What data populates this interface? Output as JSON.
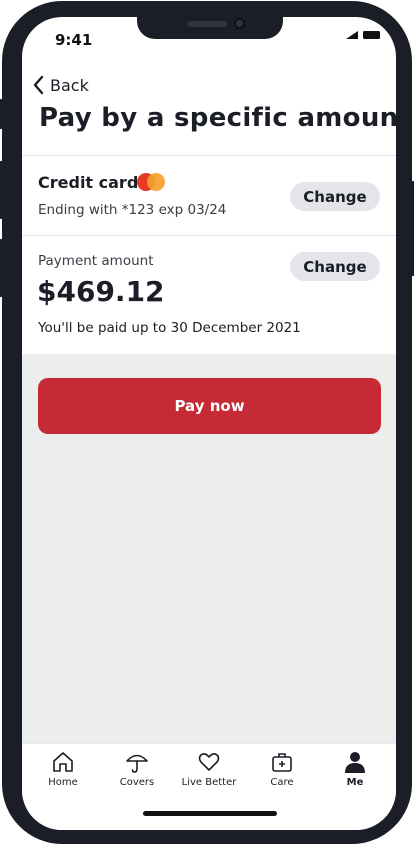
{
  "status_bar": {
    "time": "9:41"
  },
  "nav": {
    "back_label": "Back"
  },
  "page": {
    "title": "Pay by a specific amount"
  },
  "payment_method": {
    "title": "Credit card",
    "card_brand_icon": "mastercard-logo",
    "detail": "Ending with *123  exp 03/24",
    "change_label": "Change"
  },
  "payment_amount": {
    "label": "Payment amount",
    "value": "$469.12",
    "paid_up_text": "You'll be paid up to 30 December 2021",
    "change_label": "Change"
  },
  "actions": {
    "pay_now_label": "Pay now"
  },
  "tabbar": {
    "items": [
      {
        "label": "Home",
        "icon": "home-icon",
        "active": false
      },
      {
        "label": "Covers",
        "icon": "umbrella-icon",
        "active": false
      },
      {
        "label": "Live Better",
        "icon": "heart-icon",
        "active": false
      },
      {
        "label": "Care",
        "icon": "medical-kit-icon",
        "active": false
      },
      {
        "label": "Me",
        "icon": "person-icon",
        "active": true
      }
    ]
  },
  "colors": {
    "primary_red": "#c62b35",
    "change_button_bg": "#e3e5ea",
    "background_grey": "#eceeee",
    "text_dark": "#1b1e26",
    "frame": "#1b1e26"
  }
}
